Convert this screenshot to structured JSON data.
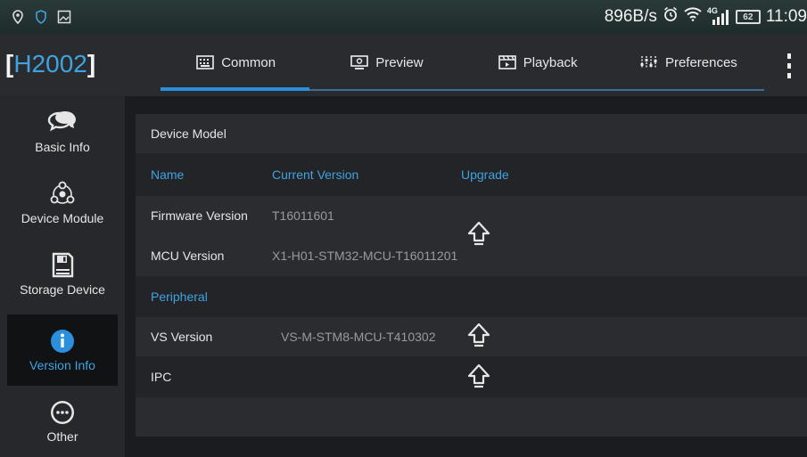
{
  "status_bar": {
    "net_speed": "896B/s",
    "network": "4G",
    "battery": "62",
    "time": "11:09",
    "icons": [
      "location-icon",
      "shield-icon",
      "image-icon",
      "alarm-icon",
      "wifi-icon",
      "signal-icon",
      "battery-icon"
    ]
  },
  "header": {
    "brand_open": "[",
    "brand_name": "H2002",
    "brand_close": "]",
    "tabs": [
      {
        "label": "Common",
        "icon": "keyboard-icon",
        "active": true
      },
      {
        "label": "Preview",
        "icon": "monitor-icon",
        "active": false
      },
      {
        "label": "Playback",
        "icon": "film-icon",
        "active": false
      },
      {
        "label": "Preferences",
        "icon": "sliders-icon",
        "active": false
      }
    ],
    "menu_icon": "kebab-menu-icon"
  },
  "sidebar": {
    "items": [
      {
        "label": "Basic Info",
        "icon": "chat-bubbles-icon",
        "active": false
      },
      {
        "label": "Device Module",
        "icon": "modules-icon",
        "active": false
      },
      {
        "label": "Storage Device",
        "icon": "floppy-disk-icon",
        "active": false
      },
      {
        "label": "Version Info",
        "icon": "info-icon",
        "active": true
      },
      {
        "label": "Other",
        "icon": "more-icon",
        "active": false
      }
    ]
  },
  "content": {
    "section_title": "Device Model",
    "columns": {
      "name": "Name",
      "version": "Current Version",
      "upgrade": "Upgrade"
    },
    "main_rows": [
      {
        "name": "Firmware Version",
        "version": "T16011601"
      },
      {
        "name": "MCU Version",
        "version": "X1-H01-STM32-MCU-T16011201"
      }
    ],
    "peripheral_title": "Peripheral",
    "peripheral_rows": [
      {
        "name": "VS  Version",
        "version": "VS-M-STM8-MCU-T410302"
      },
      {
        "name": "IPC",
        "version": ""
      }
    ],
    "upgrade_icon": "upload-arrow-icon"
  },
  "colors": {
    "accent": "#2c8fdc",
    "accent_text": "#3fa3e0",
    "background": "#1b1c1f",
    "status_bar": "#243332"
  }
}
